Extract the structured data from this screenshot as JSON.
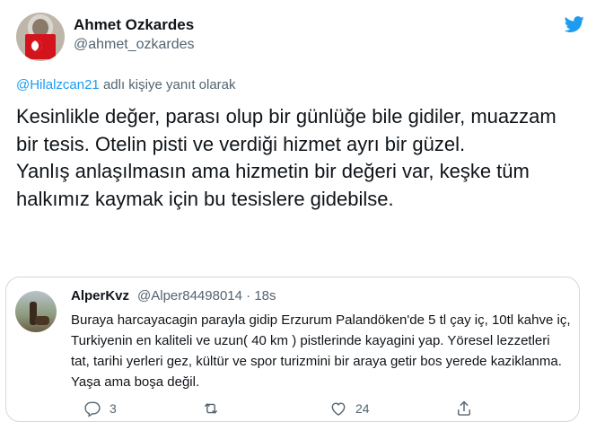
{
  "main_tweet": {
    "display_name": "Ahmet Ozkardes",
    "handle": "@ahmet_ozkardes",
    "reply_to_mention": "@Hilalzcan21",
    "reply_to_suffix": " adlı kişiye yanıt olarak",
    "text_paragraphs": [
      "Kesinlikle değer, parası olup bir günlüğe bile gidiler, muazzam bir tesis. Otelin pisti ve verdiği hizmet ayrı bir güzel.",
      "Yanlış anlaşılmasın ama hizmetin bir değeri var, keşke tüm halkımız kaymak için bu tesislere gidebilse."
    ]
  },
  "quoted_tweet": {
    "display_name": "AlperKvz",
    "meta": "@Alper84498014 · 18s",
    "text": "Buraya harcayacagin parayla gidip Erzurum Palandöken'de 5 tl çay iç, 10tl kahve iç, Turkiyenin en kaliteli ve uzun( 40 km )  pistlerinde kayagini yap. Yöresel lezzetleri tat, tarihi yerleri gez, kültür ve spor turizmini bir araya getir bos yerede kaziklanma. Yaşa ama boşa değil.",
    "actions": {
      "reply_count": "3",
      "retweet_count": "",
      "like_count": "24"
    }
  },
  "icons": {
    "brand": "twitter-bird-icon",
    "reply": "reply-icon",
    "retweet": "retweet-icon",
    "like": "heart-icon",
    "share": "share-icon"
  },
  "colors": {
    "link": "#1d9bf0",
    "secondary_text": "#536471",
    "border": "#cfd9de"
  }
}
